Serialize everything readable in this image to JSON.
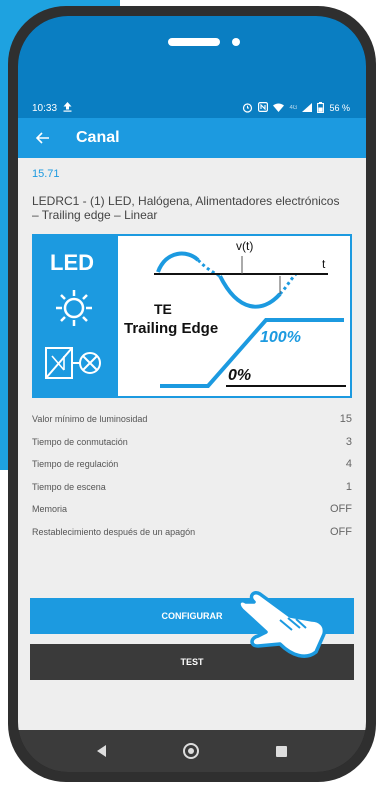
{
  "status_bar": {
    "time": "10:33",
    "upload_icon": "upload-arrow-icon",
    "network_label": "4G",
    "battery": "56 %"
  },
  "app_bar": {
    "title": "Canal",
    "back_icon": "back-arrow-icon"
  },
  "version": "15.71",
  "description": "LEDRC1 - (1) LED, Halógena, Alimentadores electrónicos – Trailing edge – Linear",
  "diagram": {
    "led_label": "LED",
    "vt_label": "v(t)",
    "t_label": "t",
    "te_label": "TE",
    "trailing_edge_label": "Trailing Edge",
    "max_label": "100%",
    "min_label": "0%"
  },
  "settings": [
    {
      "label": "Valor mínimo de luminosidad",
      "value": "15"
    },
    {
      "label": "Tiempo de conmutación",
      "value": "3"
    },
    {
      "label": "Tiempo de regulación",
      "value": "4"
    },
    {
      "label": "Tiempo de escena",
      "value": "1"
    },
    {
      "label": "Memoria",
      "value": "OFF"
    },
    {
      "label": "Restablecimiento después de un apagón",
      "value": "OFF"
    }
  ],
  "buttons": {
    "configure": "CONFIGURAR",
    "test": "TEST"
  },
  "colors": {
    "accent": "#1c9ae0",
    "status_bar": "#0a7ec2",
    "dark_button": "#3a3a3a",
    "background": "#eeeeee"
  }
}
